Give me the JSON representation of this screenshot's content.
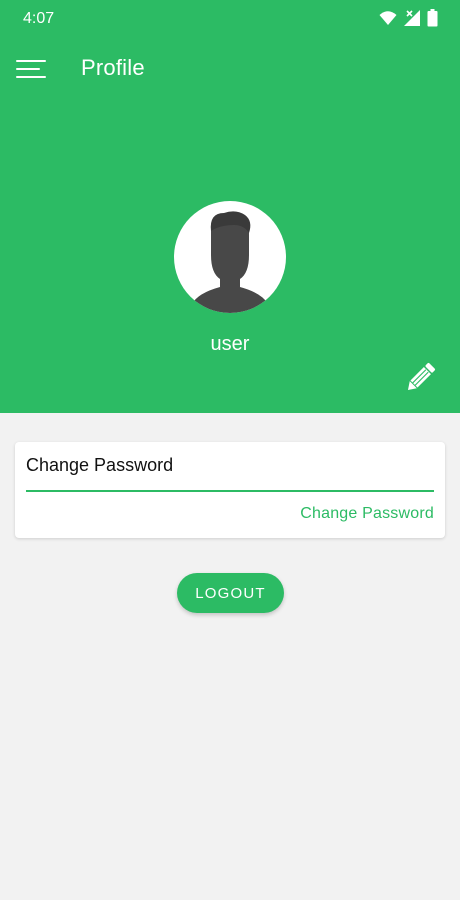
{
  "status_bar": {
    "time": "4:07",
    "icons": [
      "wifi-icon",
      "signal-icon",
      "battery-icon"
    ]
  },
  "app_bar": {
    "menu_icon": "hamburger-menu-icon",
    "title": "Profile"
  },
  "profile": {
    "avatar_icon": "user-silhouette-icon",
    "username": "user",
    "edit_icon": "pencil-icon"
  },
  "change_password_card": {
    "title": "Change Password",
    "action_label": "Change Password"
  },
  "logout": {
    "label": "LOGOUT"
  },
  "colors": {
    "accent": "#2cbb64",
    "background": "#f2f2f2",
    "card": "#ffffff",
    "avatar_silhouette": "#484848"
  }
}
